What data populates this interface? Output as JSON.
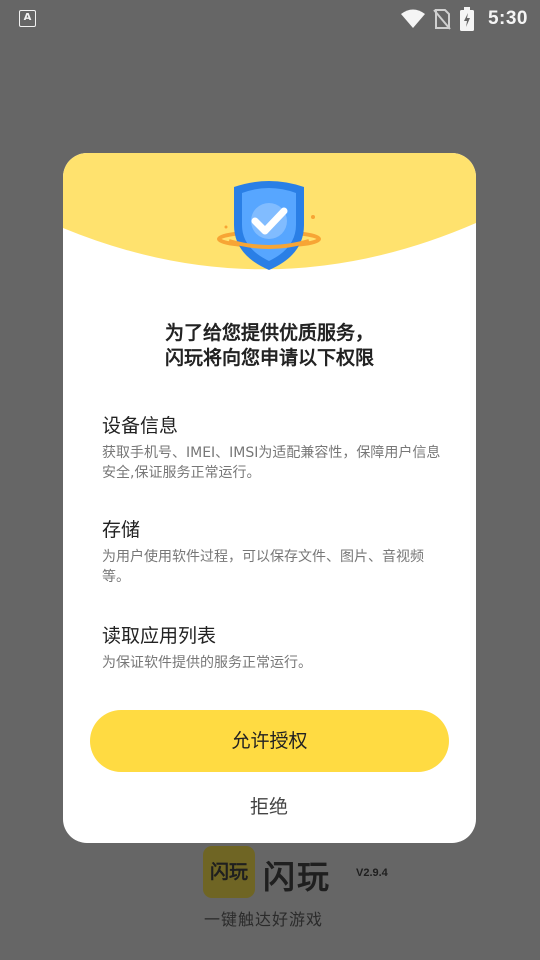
{
  "status_bar": {
    "left_icon_glyph": "A",
    "icons": [
      "accessibility-icon",
      "wifi-icon",
      "no-sim-icon",
      "battery-charging-icon"
    ],
    "time": "5:30"
  },
  "background_app": {
    "logo_text": "闪玩",
    "name": "闪玩",
    "version": "V2.9.4",
    "slogan": "一键触达好游戏"
  },
  "dialog": {
    "header_icon": "shield-check-icon",
    "colors": {
      "header": "#ffe26e",
      "button": "#ffdb42",
      "shield": "#2a7fe6"
    },
    "title_line1": "为了给您提供优质服务，",
    "title_line2": "闪玩将向您申请以下权限",
    "permissions": [
      {
        "title": "设备信息",
        "description": "获取手机号、IMEI、IMSI为适配兼容性，保障用户信息安全,保证服务正常运行。"
      },
      {
        "title": "存储",
        "description": "为用户使用软件过程，可以保存文件、图片、音视频等。"
      },
      {
        "title": "读取应用列表",
        "description": "为保证软件提供的服务正常运行。"
      }
    ],
    "allow_label": "允许授权",
    "deny_label": "拒绝"
  }
}
